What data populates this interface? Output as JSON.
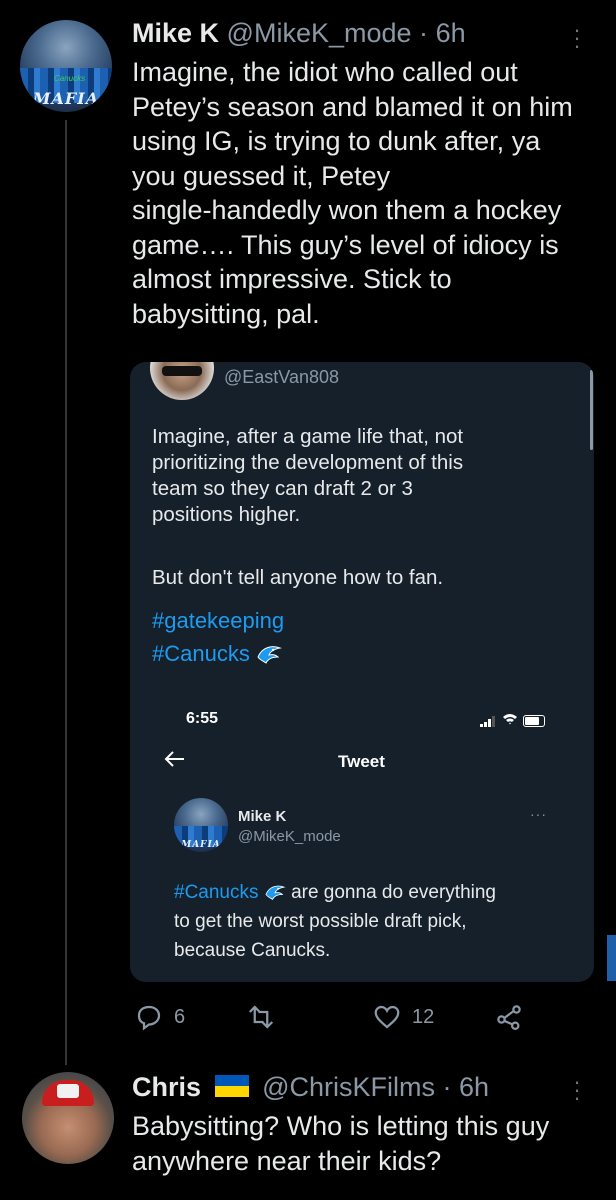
{
  "tweet1": {
    "name": "Mike K",
    "handle": "@MikeK_mode",
    "sep": "·",
    "time": "6h",
    "text_lines": [
      "Imagine, the idiot who called out",
      "Petey’s season and blamed it on him",
      "using IG, is trying to dunk after, ya",
      "you guessed it, Petey",
      "single-handedly won them a hockey",
      "game…. This guy’s level of idiocy is",
      "almost impressive. Stick to",
      "babysitting, pal."
    ],
    "avatar_text": "MAFIA",
    "avatar_small_text": "Canucks",
    "actions": {
      "reply_count": "6",
      "retweet_count": "",
      "like_count": "12"
    }
  },
  "quote": {
    "handle": "@EastVan808",
    "text_lines": [
      "Imagine, after a game life that, not",
      "prioritizing the development of this",
      "team so they can draft 2 or 3",
      "positions higher."
    ],
    "line2": "But don't tell anyone how to fan.",
    "hashtag1": "#gatekeeping",
    "hashtag2": "#Canucks",
    "screenshot": {
      "time": "6:55",
      "title": "Tweet",
      "name": "Mike K",
      "handle": "@MikeK_mode",
      "avatar_text": "MAFIA",
      "hashtag": "#Canucks",
      "line1_rest": "are gonna do everything",
      "line2": "to get the worst possible draft pick,",
      "line3": "because Canucks."
    }
  },
  "tweet2": {
    "name": "Chris",
    "handle": "@ChrisKFilms",
    "sep": "·",
    "time": "6h",
    "text_lines": [
      "Babysitting? Who is letting this guy",
      "anywhere near their kids?"
    ],
    "flag_colors": [
      "#0057b7",
      "#ffd700"
    ]
  },
  "colors": {
    "background": "#000000",
    "text": "#e7e9ea",
    "secondary": "#8b98a5",
    "link": "#1d9bf0",
    "card": "#15202b",
    "thread": "#333639"
  }
}
